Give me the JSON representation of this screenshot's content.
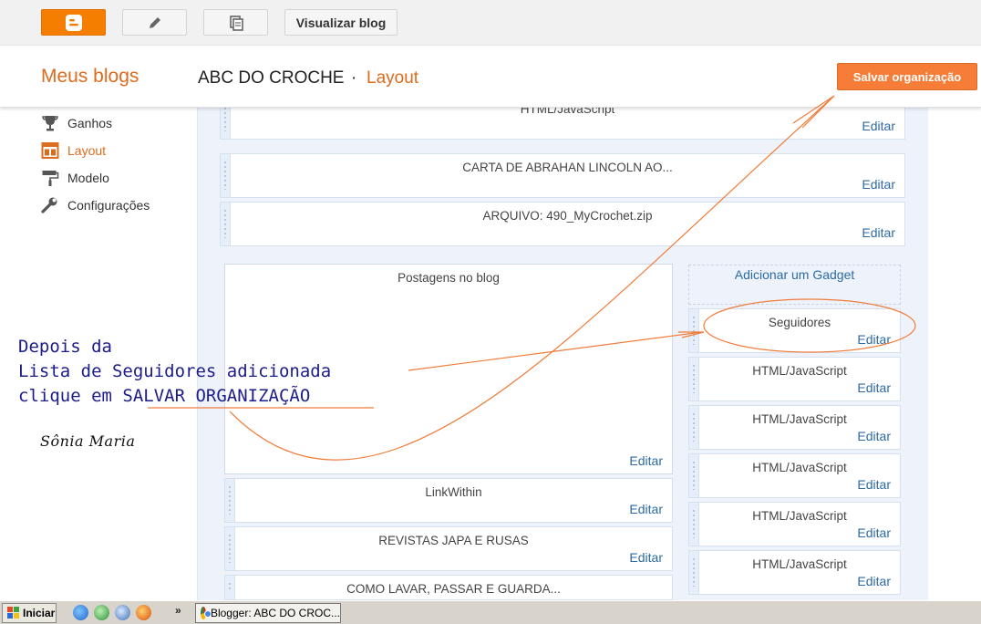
{
  "topbar": {
    "view_blog_label": "Visualizar blog"
  },
  "header": {
    "my_blogs": "Meus blogs",
    "blog_title": "ABC DO CROCHE",
    "separator": "·",
    "page_title": "Layout",
    "save_label": "Salvar organização"
  },
  "sidebar": {
    "items": [
      {
        "label": "Ganhos",
        "icon": "trophy-icon"
      },
      {
        "label": "Layout",
        "icon": "layout-icon",
        "active": true
      },
      {
        "label": "Modelo",
        "icon": "paint-roller-icon"
      },
      {
        "label": "Configurações",
        "icon": "wrench-icon"
      }
    ]
  },
  "layout": {
    "edit_label": "Editar",
    "add_gadget": "Adicionar um Gadget",
    "top_widgets": [
      {
        "name": "HTML/JavaScript"
      },
      {
        "name": "CARTA DE ABRAHAN LINCOLN AO..."
      },
      {
        "name": "ARQUIVO: 490_MyCrochet.zip"
      }
    ],
    "main_column": {
      "posts": "Postagens no blog",
      "widgets": [
        "LinkWithin",
        "REVISTAS JAPA E RUSAS",
        "COMO LAVAR, PASSAR E GUARDA..."
      ]
    },
    "side_column": {
      "widgets": [
        "Seguidores",
        "HTML/JavaScript",
        "HTML/JavaScript",
        "HTML/JavaScript",
        "HTML/JavaScript",
        "HTML/JavaScript"
      ]
    }
  },
  "annotation": {
    "line1": "Depois da",
    "line2": "Lista de Seguidores adicionada",
    "line3_prefix": "clique em ",
    "line3_highlight": "SALVAR ORGANIZAÇÃO",
    "signature": "Sônia Maria",
    "color": "#f07c3a"
  },
  "taskbar": {
    "start_label": "Iniciar",
    "more": "»",
    "window_label": "Blogger: ABC DO CROC..."
  },
  "colors": {
    "accent": "#f57d00",
    "link": "#2d6aa3",
    "editor_bg": "#eef3fb"
  }
}
